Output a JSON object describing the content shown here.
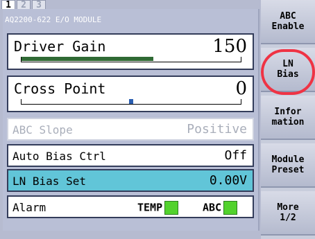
{
  "tabs": [
    {
      "label": "1",
      "active": true
    },
    {
      "label": "2",
      "active": false
    },
    {
      "label": "3",
      "active": false
    }
  ],
  "module": {
    "title": "AQ2200-622 E/O MODULE"
  },
  "driver_gain": {
    "label": "Driver Gain",
    "value": "150",
    "level_fraction": 0.6
  },
  "cross_point": {
    "label": "Cross Point",
    "value": "0",
    "marker_fraction": 0.5
  },
  "rows": [
    {
      "label": "ABC Slope",
      "value": "Positive",
      "state": "disabled"
    },
    {
      "label": "Auto Bias Ctrl",
      "value": "Off",
      "state": "normal"
    },
    {
      "label": "LN Bias Set",
      "value": "0.00V",
      "state": "selected"
    }
  ],
  "alarm": {
    "label": "Alarm",
    "indicators": [
      {
        "name": "TEMP",
        "color": "#52d22d"
      },
      {
        "name": "ABC",
        "color": "#52d22d"
      }
    ]
  },
  "sidebar": {
    "buttons": [
      {
        "label": "ABC\nEnable"
      },
      {
        "label": "LN\nBias",
        "highlighted": true
      },
      {
        "label": "Infor\nmation"
      },
      {
        "label": "Module\nPreset"
      },
      {
        "label": "More\n1/2"
      }
    ]
  },
  "colors": {
    "accent_selected_row": "#61c5d8",
    "gain_bar": "#2f6a34",
    "cross_marker": "#2b5fb1",
    "highlight_ring": "#ef3344"
  }
}
